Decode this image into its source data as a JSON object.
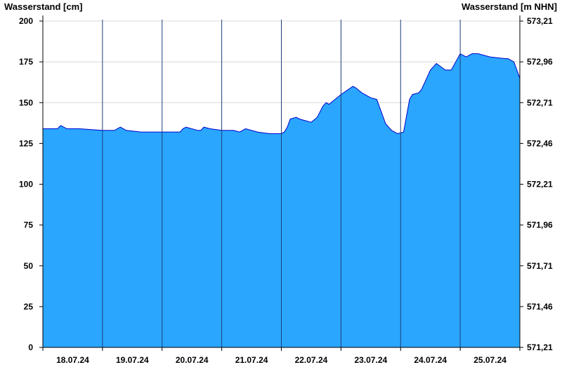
{
  "chart_data": {
    "type": "area",
    "ylabel_left": "Wasserstand [cm]",
    "ylabel_right": "Wasserstand [m NHN]",
    "ylim": [
      0,
      200
    ],
    "y_ticks_left": [
      "0",
      "25",
      "50",
      "75",
      "100",
      "125",
      "150",
      "175",
      "200"
    ],
    "y_ticks_right": [
      "571,21",
      "571,46",
      "571,71",
      "571,96",
      "572,21",
      "572,46",
      "572,71",
      "572,96",
      "573,21"
    ],
    "x_ticks": [
      "18.07.24",
      "19.07.24",
      "20.07.24",
      "21.07.24",
      "22.07.24",
      "23.07.24",
      "24.07.24",
      "25.07.24"
    ],
    "grid": true,
    "colors": {
      "fill": "#2aa6ff",
      "line": "#0000cc",
      "grid": "#d8d8d8",
      "axis": "#000000"
    },
    "series": [
      {
        "x": [
          0,
          0.25,
          0.27,
          0.3,
          0.35,
          0.4,
          0.6,
          1.0,
          1.2,
          1.25,
          1.3,
          1.4,
          1.65,
          2.0,
          2.3,
          2.35,
          2.4,
          2.6,
          2.65,
          2.7,
          2.8,
          3.0,
          3.2,
          3.3,
          3.35,
          3.4,
          3.6,
          3.8,
          4.0,
          4.05,
          4.1,
          4.15,
          4.25,
          4.3,
          4.5,
          4.6,
          4.7,
          4.75,
          4.8,
          4.9,
          5.0,
          5.2,
          5.25,
          5.35,
          5.5,
          5.6,
          5.75,
          5.85,
          5.95,
          6.05,
          6.15,
          6.2,
          6.3,
          6.35,
          6.4,
          6.45,
          6.5,
          6.6,
          6.75,
          6.85,
          7.0,
          7.1,
          7.2,
          7.3,
          7.5,
          7.75,
          7.8,
          7.9,
          8.0
        ],
        "y": [
          134,
          134,
          135,
          136,
          135,
          134,
          134,
          133,
          133,
          134,
          135,
          133,
          132,
          132,
          132,
          134,
          135,
          133,
          133,
          135,
          134,
          133,
          133,
          132,
          133,
          134,
          132,
          131,
          131,
          132,
          135,
          140,
          141,
          140,
          138,
          141,
          148,
          150,
          149,
          152,
          155,
          160,
          159,
          156,
          153,
          152,
          137,
          133,
          131,
          132,
          152,
          155,
          156,
          158,
          162,
          166,
          170,
          174,
          170,
          170,
          180,
          178,
          180,
          180,
          178,
          177,
          177,
          175,
          165
        ]
      }
    ]
  }
}
